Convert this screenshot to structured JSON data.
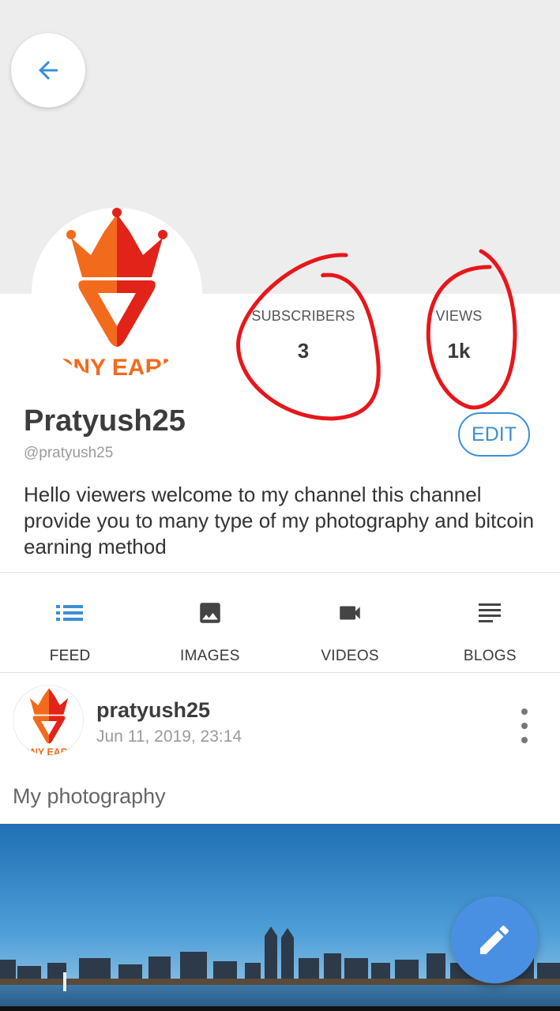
{
  "header": {
    "back_icon": "arrow-left-icon"
  },
  "profile": {
    "logo_text": "ONY EARN",
    "name": "Pratyush25",
    "handle": "@pratyush25",
    "edit_label": "EDIT",
    "bio": "Hello viewers welcome to my channel this channel provide you to many type of my photography and bitcoin earning method",
    "stats": {
      "subscribers_label": "SUBSCRIBERS",
      "subscribers_value": "3",
      "views_label": "VIEWS",
      "views_value": "1k"
    }
  },
  "tabs": [
    {
      "label": "FEED",
      "icon": "list-icon",
      "active": true
    },
    {
      "label": "IMAGES",
      "icon": "image-icon",
      "active": false
    },
    {
      "label": "VIDEOS",
      "icon": "video-camera-icon",
      "active": false
    },
    {
      "label": "BLOGS",
      "icon": "text-lines-icon",
      "active": false
    }
  ],
  "post": {
    "user": "pratyush25",
    "date": "Jun 11, 2019, 23:14",
    "caption": "My photography"
  },
  "fab": {
    "icon": "pencil-icon"
  },
  "colors": {
    "accent": "#3b8fd6",
    "fab": "#4a90e2",
    "annotation": "#e8161b",
    "cover": "#ededed"
  }
}
